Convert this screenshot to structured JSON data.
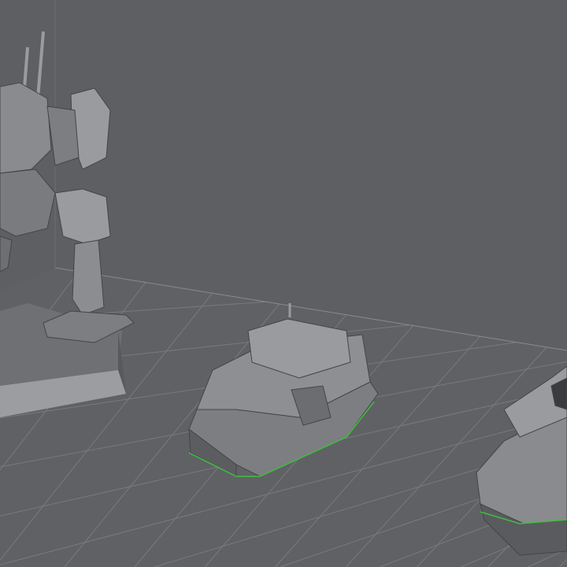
{
  "scene": {
    "colors": {
      "background": "#5e5f62",
      "floor": "#606164",
      "grid_line": "#78797c",
      "model_light": "#9a9b9e",
      "model_mid": "#7d7e81",
      "model_dark": "#4a4b4e",
      "selection_edge": "#3fbf3f"
    }
  }
}
